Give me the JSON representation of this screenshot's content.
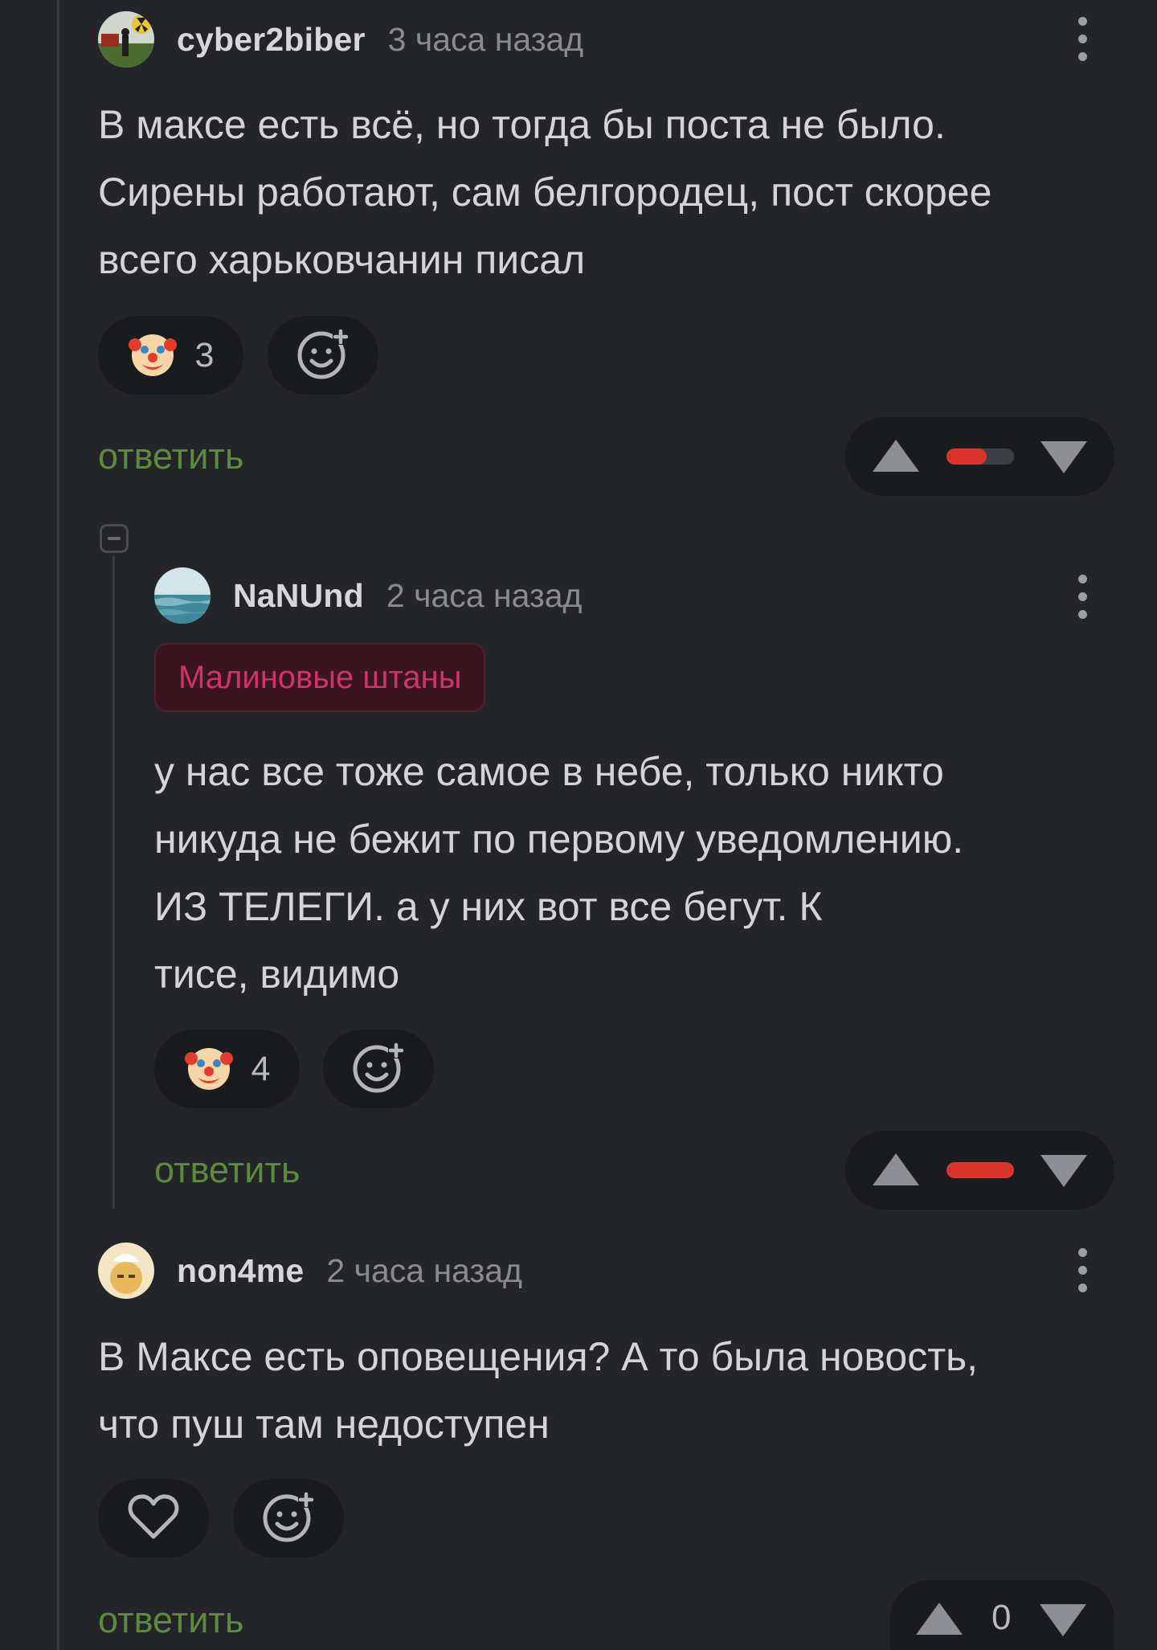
{
  "comments": [
    {
      "username": "cyber2biber",
      "time": "3 часа назад",
      "lines": [
        "В максе есть всё, но тогда бы поста не было.",
        "Сирены работают, сам белгородец, пост скорее",
        "всего харьковчанин писал"
      ],
      "reaction": {
        "icon": "clown-emoji",
        "count": "3"
      },
      "add_reaction_icon": "add-emoji-icon",
      "reply_label": "ответить",
      "rating_fraction": 0.6
    },
    {
      "username": "NaNUnd",
      "time": "2 часа назад",
      "badge": "Малиновые штаны",
      "lines": [
        "у нас все тоже самое в небе, только никто",
        "никуда не бежит по первому уведомлению.",
        "ИЗ ТЕЛЕГИ. а у них вот все бегут. К",
        "тисе, видимо"
      ],
      "reaction": {
        "icon": "clown-emoji",
        "count": "4"
      },
      "add_reaction_icon": "add-emoji-icon",
      "reply_label": "ответить",
      "rating_fraction": 1.0
    },
    {
      "username": "non4me",
      "time": "2 часа назад",
      "lines": [
        "В Максе есть оповещения? А то была новость,",
        "что пуш там недоступен"
      ],
      "like_icon": "heart-icon",
      "add_reaction_icon": "add-emoji-icon",
      "reply_label": "ответить",
      "vote_count": "0"
    }
  ],
  "colors": {
    "background": "#242529",
    "reply_link": "#5c8b3e",
    "rating_negative": "#d9342b",
    "badge_text": "#d0336b"
  }
}
